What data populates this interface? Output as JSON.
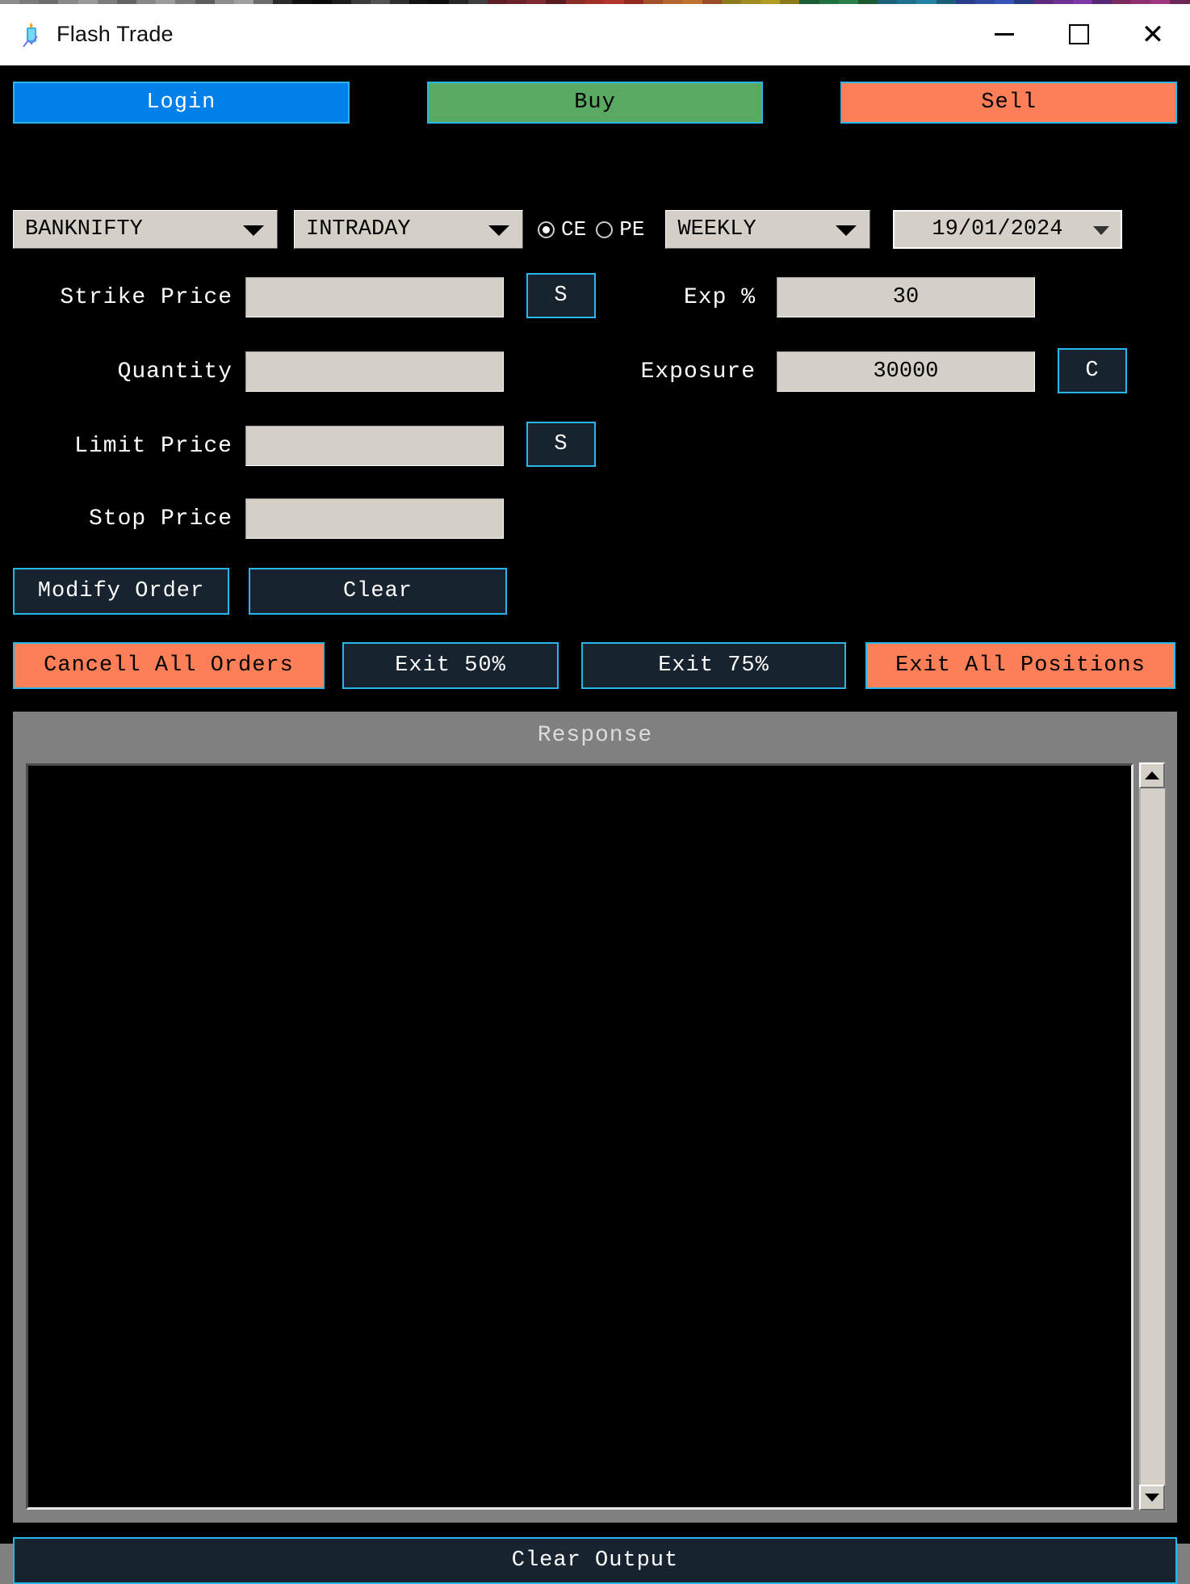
{
  "desktop_strip": {
    "colors": [
      "#8c8c8c",
      "#7a7a7a",
      "#6e6e6e",
      "#8a8a8a",
      "#9a9a9a",
      "#7d7d7d",
      "#636363",
      "#888888",
      "#9c9c9c",
      "#7a7a7a",
      "#5e5e5e",
      "#8d8d8d",
      "#a0a0a0",
      "#6b6b6b",
      "#2b2b2b",
      "#111111",
      "#0a0a0a",
      "#1c1c1c",
      "#3a3a3a",
      "#525252",
      "#2e2e2e",
      "#121212",
      "#0d0d0d",
      "#262626",
      "#3f3f3f",
      "#5c1e24",
      "#6d2128",
      "#7e2a30",
      "#5a1b20",
      "#8c2c26",
      "#a33028",
      "#b2362c",
      "#93291f",
      "#a1522a",
      "#b5652f",
      "#c07232",
      "#9a4d26",
      "#8d7a1c",
      "#a08c20",
      "#b39b24",
      "#8c7a1a",
      "#1e5c34",
      "#23703f",
      "#287f48",
      "#1d5a33",
      "#1c5f7a",
      "#20708f",
      "#2481a6",
      "#1a5d78",
      "#2a3f8c",
      "#3049a3",
      "#3653b8",
      "#263a82",
      "#5d2a80",
      "#6d3193",
      "#7d38a6",
      "#542777",
      "#7a2a5e",
      "#8e3070",
      "#a13680",
      "#6e2655"
    ]
  },
  "window": {
    "title": "Flash Trade",
    "icon_name": "flash-trade-icon",
    "controls": {
      "minimize": "minimize",
      "maximize": "maximize",
      "close": "close"
    }
  },
  "actions": {
    "login": "Login",
    "buy": "Buy",
    "sell": "Sell",
    "login_color": "#0080E8",
    "buy_color": "#5aa963",
    "sell_color": "#fd7f57"
  },
  "selectors": {
    "symbol": "BANKNIFTY",
    "product": "INTRADAY",
    "option_type": {
      "ce_label": "CE",
      "pe_label": "PE",
      "selected": "CE"
    },
    "expiry_type": "WEEKLY",
    "expiry_date": "19/01/2024"
  },
  "form": {
    "strike_price": {
      "label": "Strike Price",
      "value": ""
    },
    "strike_btn": "S",
    "exp_pct": {
      "label": "Exp %",
      "value": "30"
    },
    "quantity": {
      "label": "Quantity",
      "value": ""
    },
    "exposure": {
      "label": "Exposure",
      "value": "30000"
    },
    "exposure_btn": "C",
    "limit_price": {
      "label": "Limit Price",
      "value": ""
    },
    "limit_btn": "S",
    "stop_price": {
      "label": "Stop Price",
      "value": ""
    }
  },
  "order_buttons": {
    "modify_order": "Modify Order",
    "clear": "Clear"
  },
  "exit_buttons": {
    "cancel_all": "Cancell All Orders",
    "exit_50": "Exit 50%",
    "exit_75": "Exit 75%",
    "exit_all": "Exit All Positions"
  },
  "response": {
    "title": "Response",
    "output_text": "",
    "scroll_up_icon": "scroll-up-arrow",
    "scroll_down_icon": "scroll-down-arrow"
  },
  "footer": {
    "clear_output": "Clear Output"
  },
  "theme": {
    "accent": "#29b6ea",
    "panel": "#17232e",
    "background": "#000000",
    "field": "#d4d0c8"
  }
}
